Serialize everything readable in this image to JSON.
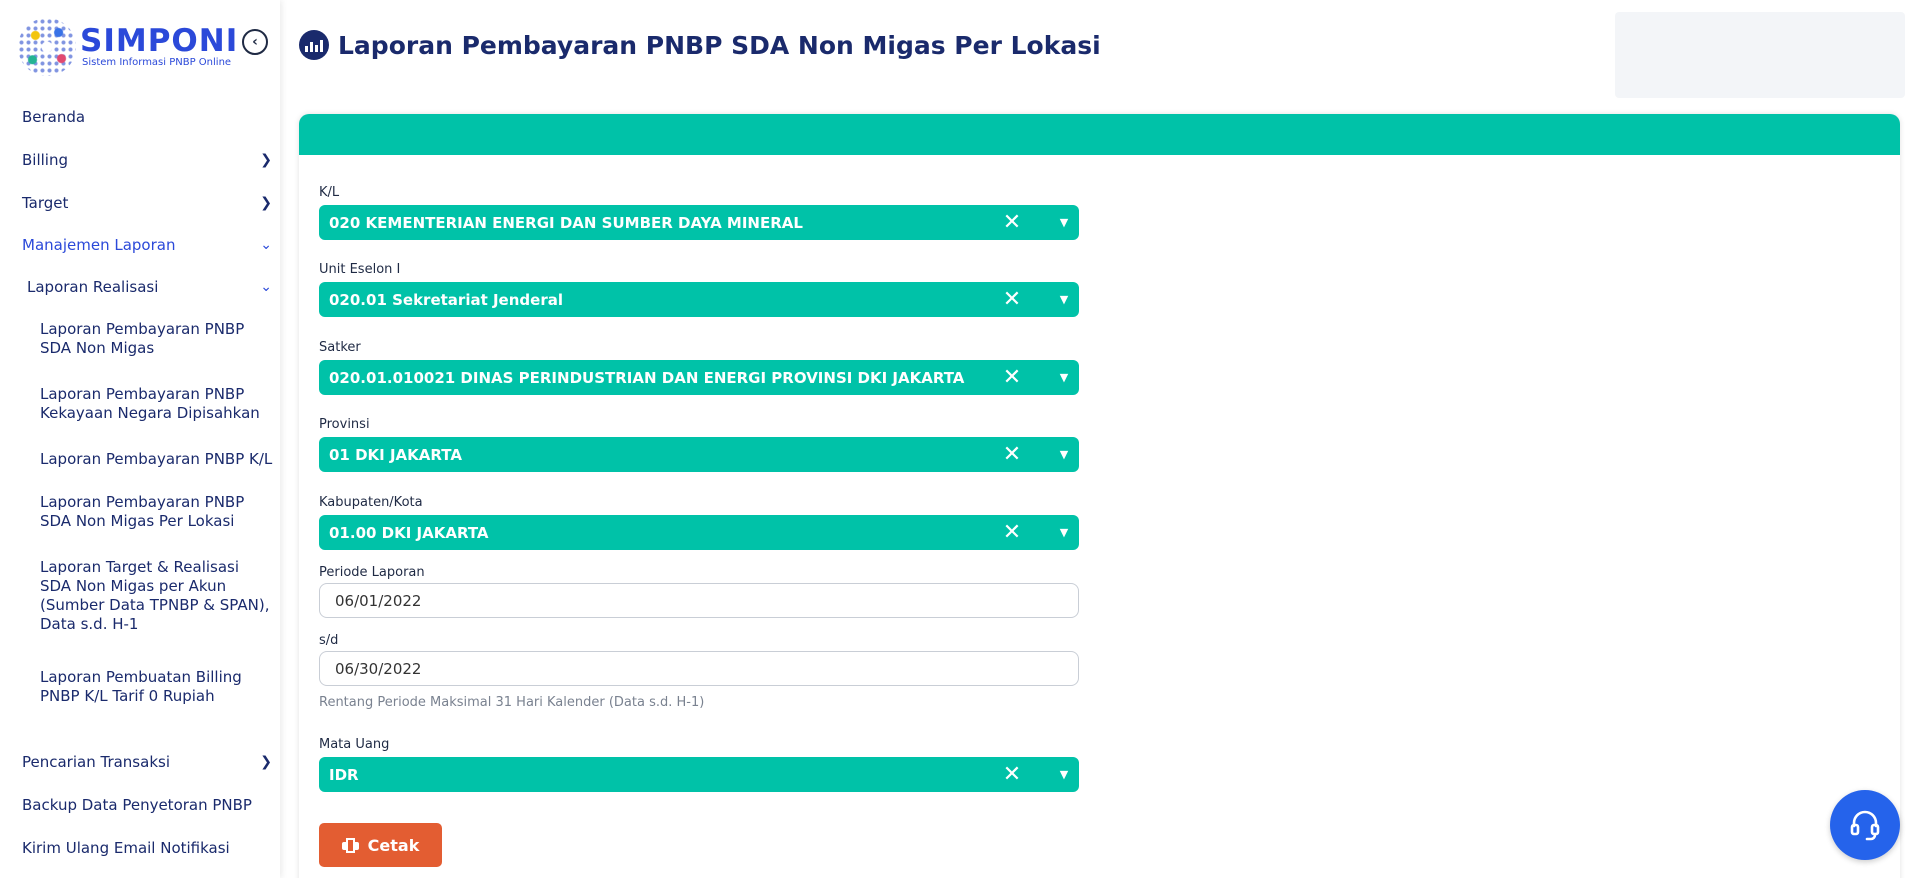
{
  "brand": {
    "title": "SIMPONI",
    "subtitle": "Sistem Informasi PNBP Online"
  },
  "sidebar": {
    "items": [
      {
        "label": "Beranda"
      },
      {
        "label": "Billing"
      },
      {
        "label": "Target"
      },
      {
        "label": "Manajemen Laporan"
      },
      {
        "label": "Laporan Realisasi"
      },
      {
        "label": "Laporan Pembayaran PNBP SDA Non Migas"
      },
      {
        "label": "Laporan Pembayaran PNBP Kekayaan Negara Dipisahkan"
      },
      {
        "label": "Laporan Pembayaran PNBP K/L"
      },
      {
        "label": "Laporan Pembayaran PNBP SDA Non Migas Per Lokasi"
      },
      {
        "label": "Laporan Target & Realisasi SDA Non Migas per Akun (Sumber Data TPNBP & SPAN), Data s.d. H-1"
      },
      {
        "label": "Laporan Pembuatan Billing PNBP K/L Tarif 0 Rupiah"
      },
      {
        "label": "Pencarian Transaksi"
      },
      {
        "label": "Backup Data Penyetoran PNBP"
      },
      {
        "label": "Kirim Ulang Email Notifikasi"
      }
    ]
  },
  "page": {
    "title": "Laporan Pembayaran PNBP SDA Non Migas Per Lokasi"
  },
  "form": {
    "kl": {
      "label": "K/L",
      "value": "020 KEMENTERIAN ENERGI DAN SUMBER DAYA MINERAL"
    },
    "eselon": {
      "label": "Unit Eselon I",
      "value": "020.01 Sekretariat Jenderal"
    },
    "satker": {
      "label": "Satker",
      "value": "020.01.010021 DINAS PERINDUSTRIAN DAN ENERGI PROVINSI DKI JAKARTA"
    },
    "provinsi": {
      "label": "Provinsi",
      "value": "01 DKI JAKARTA"
    },
    "kabupaten": {
      "label": "Kabupaten/Kota",
      "value": "01.00 DKI JAKARTA"
    },
    "periode": {
      "label": "Periode Laporan",
      "value": "06/01/2022"
    },
    "sd": {
      "label": "s/d",
      "value": "06/30/2022"
    },
    "hint": "Rentang Periode Maksimal 31 Hari Kalender (Data s.d. H-1)",
    "mata_uang": {
      "label": "Mata Uang",
      "value": "IDR"
    },
    "print_label": "Cetak"
  },
  "colors": {
    "accent": "#00c2a8",
    "navy": "#1a2a6c",
    "brand_blue": "#2b49d9",
    "print": "#e35d32",
    "help": "#2563eb"
  },
  "icons": {
    "collapse": "chevron-left-circle-icon",
    "title": "bar-chart-icon",
    "clear": "close-icon",
    "dropdown": "chevron-down-icon",
    "print": "printer-icon",
    "help": "headset-icon"
  }
}
